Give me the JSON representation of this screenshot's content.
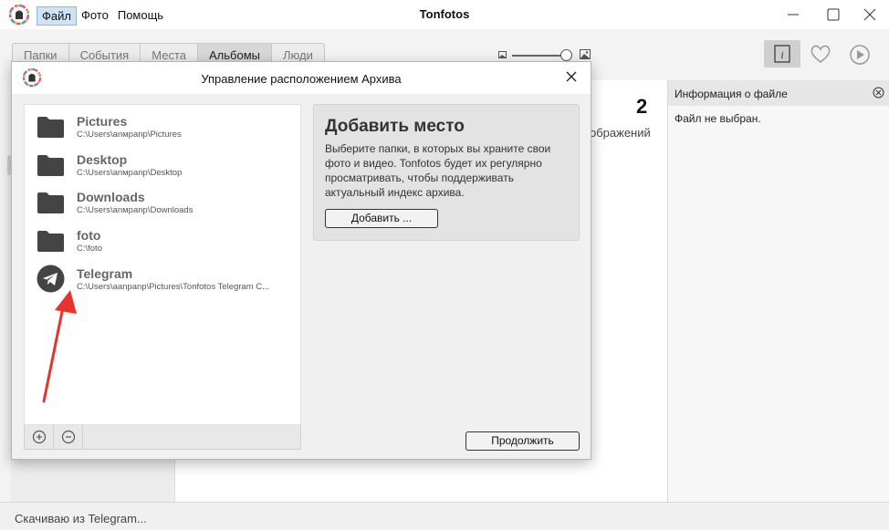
{
  "app": {
    "title": "Tonfotos",
    "menu": [
      "Файл",
      "Фото",
      "Помощь"
    ]
  },
  "toolbar": {
    "tabs": [
      "Папки",
      "События",
      "Места",
      "Альбомы",
      "Люди"
    ],
    "selected_tab": "Альбомы",
    "zoom_level": 0.9
  },
  "main": {
    "count_number": "2",
    "count_label": "ображений"
  },
  "info_panel": {
    "title": "Информация о файле",
    "text": "Файл не выбран."
  },
  "status": {
    "text": "Скачиваю из Telegram..."
  },
  "dialog": {
    "title": "Управление расположением Архива",
    "folders": [
      {
        "name": "Pictures",
        "path": "C:\\Users\\anмpanp\\Pictures",
        "icon": "folder-icon"
      },
      {
        "name": "Desktop",
        "path": "C:\\Users\\anмpanp\\Desktop",
        "icon": "folder-icon"
      },
      {
        "name": "Downloads",
        "path": "C:\\Users\\anмpanp\\Downloads",
        "icon": "folder-icon"
      },
      {
        "name": "foto",
        "path": "C:\\foto",
        "icon": "folder-icon"
      },
      {
        "name": "Telegram",
        "path": "C:\\Users\\aanpanp\\Pictures\\Tonfotos Telegram C...",
        "icon": "telegram-icon"
      }
    ],
    "add_panel": {
      "title": "Добавить место",
      "description": "Выберите папки, в которых вы храните свои фото и видео. Tonfotos будет их регулярно просматривать, чтобы поддерживать актуальный индекс архива.",
      "button_label": "Добавить ..."
    },
    "continue_label": "Продолжить"
  },
  "colors": {
    "menu_highlight": "#cfe3f7",
    "annotation_arrow": "#e8322c",
    "folder_icon": "#444444"
  }
}
